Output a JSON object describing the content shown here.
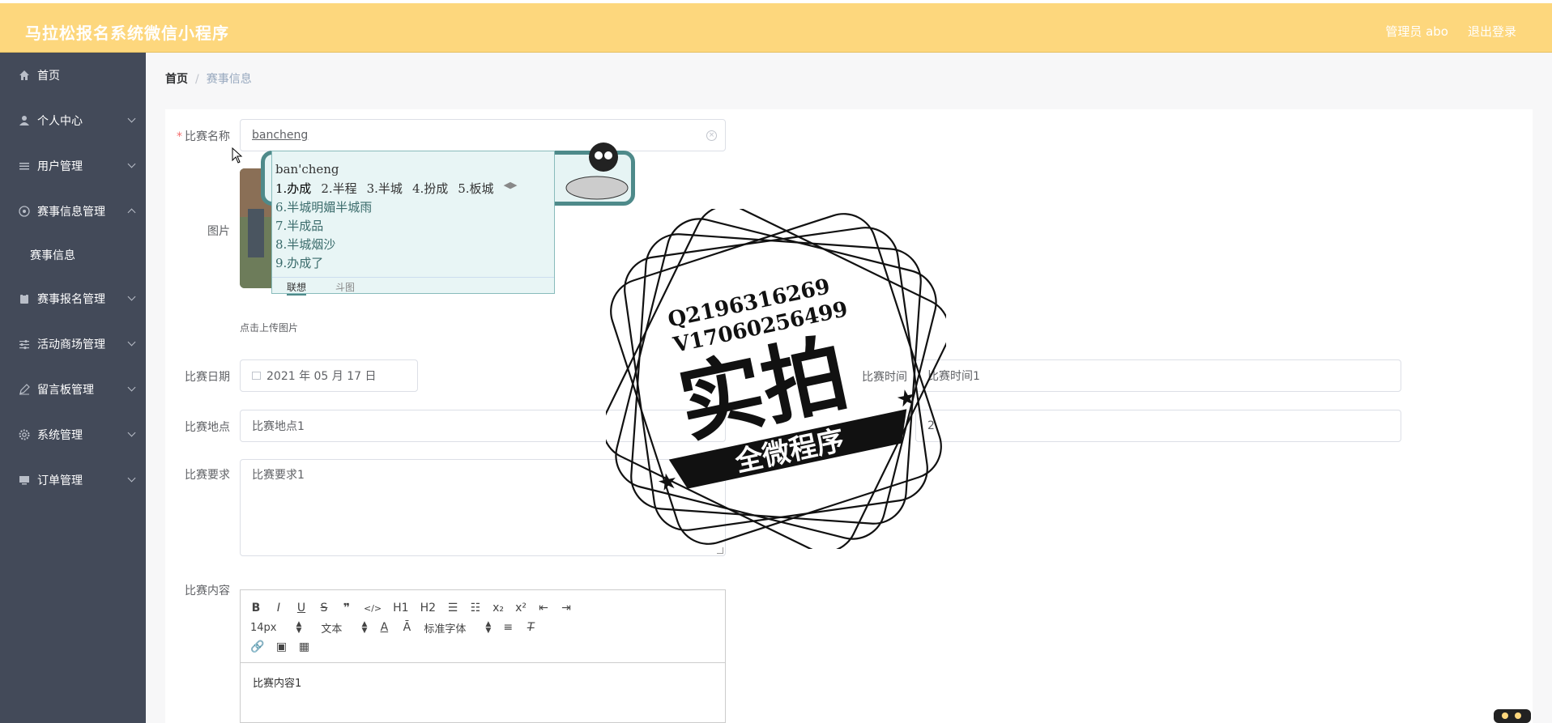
{
  "header": {
    "app_title": "马拉松报名系统微信小程序",
    "admin_label": "管理员 abo",
    "logout_label": "退出登录"
  },
  "sidebar": {
    "items": [
      {
        "label": "首页",
        "icon": "home-icon"
      },
      {
        "label": "个人中心",
        "icon": "user-icon"
      },
      {
        "label": "用户管理",
        "icon": "list-icon"
      },
      {
        "label": "赛事信息管理",
        "icon": "compass-icon"
      },
      {
        "label": "赛事信息",
        "icon": ""
      },
      {
        "label": "赛事报名管理",
        "icon": "clipboard-icon"
      },
      {
        "label": "活动商场管理",
        "icon": "sliders-icon"
      },
      {
        "label": "留言板管理",
        "icon": "pen-icon"
      },
      {
        "label": "系统管理",
        "icon": "gear-icon"
      },
      {
        "label": "订单管理",
        "icon": "monitor-icon"
      }
    ]
  },
  "breadcrumb": {
    "home": "首页",
    "separator": "/",
    "current": "赛事信息"
  },
  "form": {
    "name_label": "比赛名称",
    "name_value": "bancheng",
    "image_label": "图片",
    "upload_tip": "点击上传图片",
    "date_label": "比赛日期",
    "date_value": "2021 年 05 月 17 日",
    "time_label": "比赛时间",
    "time_value": "比赛时间1",
    "place_label": "比赛地点",
    "place_value": "比赛地点1",
    "people_value": "2",
    "requirement_label": "比赛要求",
    "requirement_value": "比赛要求1",
    "content_label": "比赛内容",
    "content_value": "比赛内容1"
  },
  "editor_toolbar": {
    "font_size": "14px",
    "text_style": "文本",
    "font_family": "标准字体",
    "h1": "H1",
    "h2": "H2"
  },
  "ime": {
    "pinyin": "ban'cheng",
    "candidates": [
      "1.办成",
      "2.半程",
      "3.半城",
      "4.扮成",
      "5.板城"
    ],
    "more": [
      "6.半城明媚半城雨",
      "7.半成品",
      "8.半城烟沙",
      "9.办成了"
    ],
    "tab_assoc": "联想",
    "tab_sticker": "斗图"
  },
  "watermark": {
    "qq": "Q2196316269",
    "wx": "V17060256499",
    "big_text": "实拍",
    "ribbon": "全微程序"
  },
  "colors": {
    "header_bg": "#fdd77d",
    "sidebar_bg": "#434a59"
  }
}
